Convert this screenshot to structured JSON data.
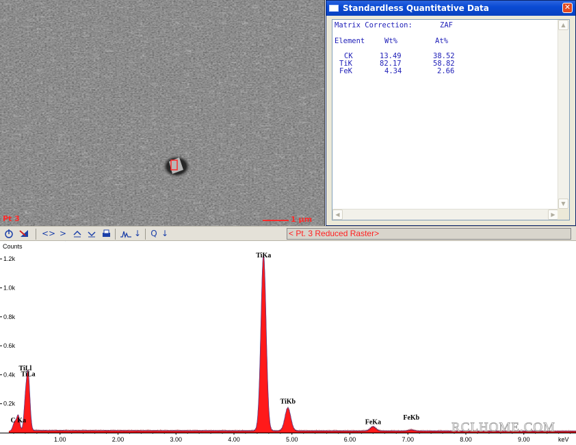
{
  "sem": {
    "point_label": "Pt 3",
    "scale_label": "1 µm"
  },
  "quant": {
    "title": "Standardless Quantitative Data",
    "close_label": "✕",
    "matrix_label": "Matrix Correction:",
    "matrix_value": "ZAF",
    "col_element": "Element",
    "col_wt": "Wt%",
    "col_at": "At%",
    "rows": [
      {
        "element": "CK",
        "wt": "13.49",
        "at": "38.52"
      },
      {
        "element": "TiK",
        "wt": "82.17",
        "at": "58.82"
      },
      {
        "element": "FeK",
        "wt": "4.34",
        "at": "2.66"
      }
    ]
  },
  "toolbar": {
    "raster_label": "< Pt. 3 Reduced Raster>",
    "icons": [
      "marker-icon",
      "tool-icon",
      "expand-horizontal-icon",
      "compress-horizontal-icon",
      "expand-vertical-icon",
      "compress-vertical-icon",
      "print-icon",
      "peak-id-icon",
      "down-arrow-icon",
      "zoom-icon",
      "down-arrow-icon"
    ]
  },
  "chart_data": {
    "type": "line",
    "ylabel": "Counts",
    "xlabel": "keV",
    "xlim": [
      0,
      9.9
    ],
    "ylim": [
      0,
      1.3
    ],
    "x_ticks": [
      "1.00",
      "2.00",
      "3.00",
      "4.00",
      "5.00",
      "6.00",
      "7.00",
      "8.00",
      "9.00"
    ],
    "y_ticks": [
      "0.2k",
      "0.4k",
      "0.6k",
      "0.8k",
      "1.0k",
      "1.2k"
    ],
    "peak_labels": [
      {
        "text": "TiLl",
        "x": 0.4,
        "y": 0.43
      },
      {
        "text": "TiLa",
        "x": 0.45,
        "y": 0.39
      },
      {
        "text": "C Ka",
        "x": 0.28,
        "y": 0.07
      },
      {
        "text": "TiKa",
        "x": 4.51,
        "y": 1.21
      },
      {
        "text": "TiKb",
        "x": 4.93,
        "y": 0.2
      },
      {
        "text": "FeKa",
        "x": 6.4,
        "y": 0.06
      },
      {
        "text": "FeKb",
        "x": 7.06,
        "y": 0.09
      }
    ],
    "peaks": [
      {
        "x": 0.22,
        "y": 0.06,
        "w": 0.03
      },
      {
        "x": 0.28,
        "y": 0.1,
        "w": 0.025
      },
      {
        "x": 0.4,
        "y": 0.16,
        "w": 0.025
      },
      {
        "x": 0.45,
        "y": 0.39,
        "w": 0.03
      },
      {
        "x": 4.51,
        "y": 1.22,
        "w": 0.045
      },
      {
        "x": 4.93,
        "y": 0.16,
        "w": 0.05
      },
      {
        "x": 6.4,
        "y": 0.03,
        "w": 0.05
      },
      {
        "x": 7.06,
        "y": 0.008,
        "w": 0.05
      }
    ],
    "background_level": 0.015,
    "fill_color": "#ff1a1a",
    "fit_color": "#3050c0"
  },
  "watermark": "RCLHOME.COM"
}
